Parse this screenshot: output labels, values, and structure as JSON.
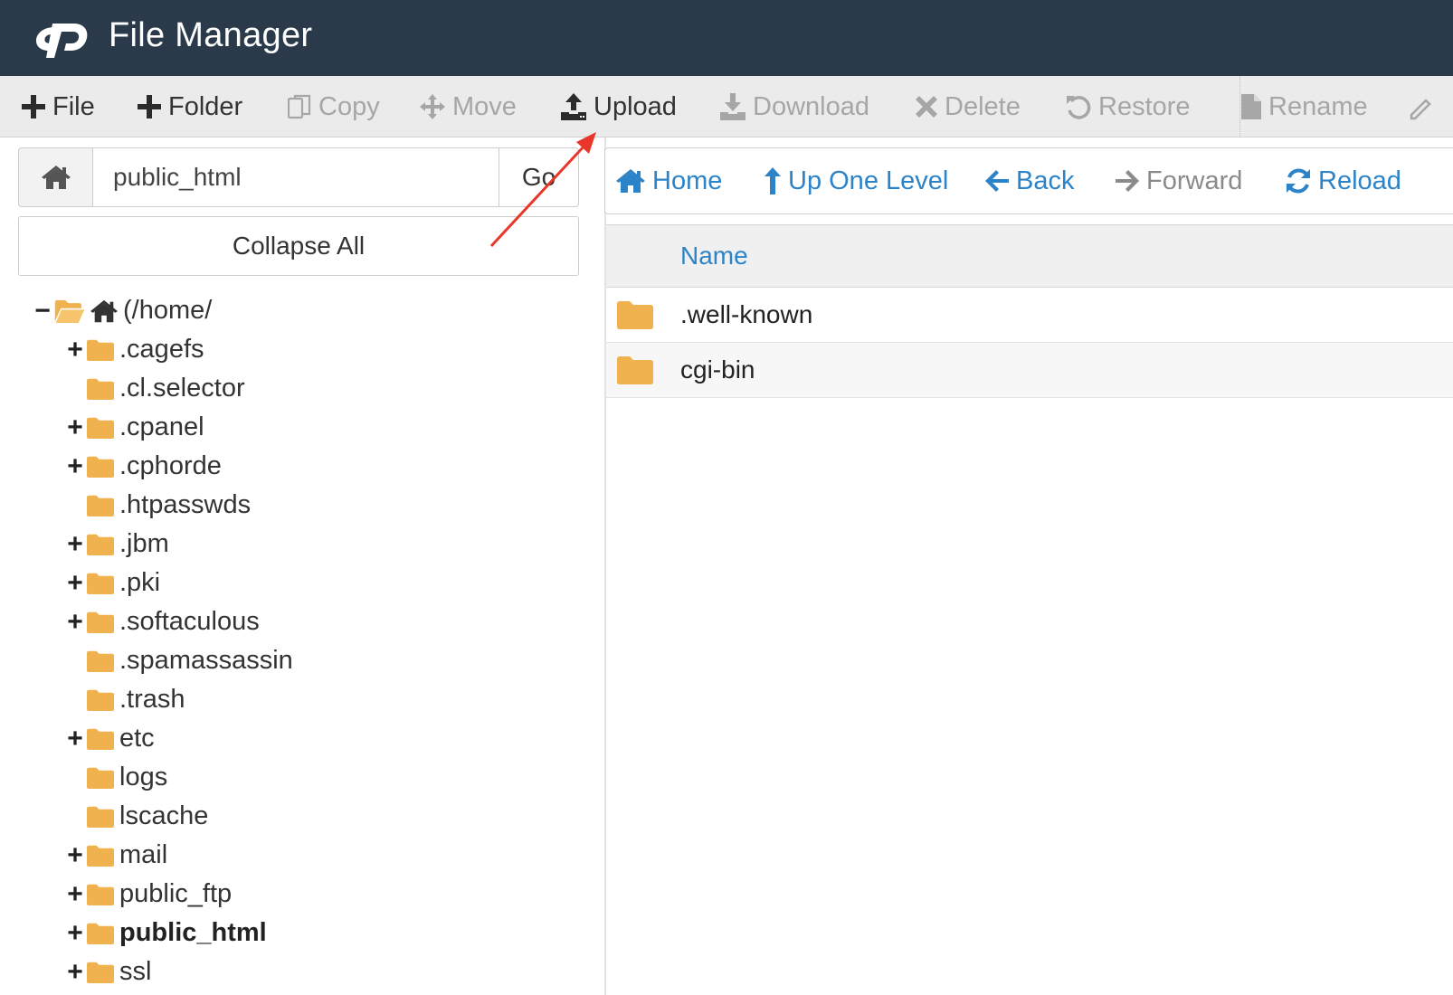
{
  "header": {
    "title": "File Manager",
    "logo_icon": "cpanel-logo"
  },
  "toolbar": {
    "items": [
      {
        "label": "File",
        "icon": "plus-icon",
        "enabled": true
      },
      {
        "label": "Folder",
        "icon": "plus-icon",
        "enabled": true
      },
      {
        "label": "Copy",
        "icon": "copy-icon",
        "enabled": false
      },
      {
        "label": "Move",
        "icon": "move-icon",
        "enabled": false
      },
      {
        "label": "Upload",
        "icon": "upload-icon",
        "enabled": true
      },
      {
        "label": "Download",
        "icon": "download-icon",
        "enabled": false
      },
      {
        "label": "Delete",
        "icon": "times-icon",
        "enabled": false
      },
      {
        "label": "Restore",
        "icon": "undo-icon",
        "enabled": false
      },
      {
        "label": "Rename",
        "icon": "file-icon",
        "enabled": false
      }
    ]
  },
  "left": {
    "path_value": "public_html",
    "go_label": "Go",
    "collapse_label": "Collapse All",
    "tree": [
      {
        "label": "(/home/",
        "toggle": "−",
        "type": "root"
      },
      {
        "label": ".cagefs",
        "toggle": "+"
      },
      {
        "label": ".cl.selector",
        "toggle": ""
      },
      {
        "label": ".cpanel",
        "toggle": "+"
      },
      {
        "label": ".cphorde",
        "toggle": "+"
      },
      {
        "label": ".htpasswds",
        "toggle": ""
      },
      {
        "label": ".jbm",
        "toggle": "+"
      },
      {
        "label": ".pki",
        "toggle": "+"
      },
      {
        "label": ".softaculous",
        "toggle": "+"
      },
      {
        "label": ".spamassassin",
        "toggle": ""
      },
      {
        "label": ".trash",
        "toggle": ""
      },
      {
        "label": "etc",
        "toggle": "+"
      },
      {
        "label": "logs",
        "toggle": ""
      },
      {
        "label": "lscache",
        "toggle": ""
      },
      {
        "label": "mail",
        "toggle": "+"
      },
      {
        "label": "public_ftp",
        "toggle": "+"
      },
      {
        "label": "public_html",
        "toggle": "+",
        "bold": true
      },
      {
        "label": "ssl",
        "toggle": "+"
      }
    ]
  },
  "right": {
    "nav": [
      {
        "label": "Home",
        "icon": "home-icon",
        "active": true
      },
      {
        "label": "Up One Level",
        "icon": "level-up-icon",
        "active": true
      },
      {
        "label": "Back",
        "icon": "arrow-left-icon",
        "active": true
      },
      {
        "label": "Forward",
        "icon": "arrow-right-icon",
        "active": false
      },
      {
        "label": "Reload",
        "icon": "refresh-icon",
        "active": true
      }
    ],
    "column_name": "Name",
    "files": [
      {
        "name": ".well-known",
        "type": "folder"
      },
      {
        "name": "cgi-bin",
        "type": "folder"
      }
    ]
  },
  "colors": {
    "header_bg": "#2a3a4a",
    "accent_blue": "#2d83c7",
    "folder": "#f0b24e",
    "annotation_arrow": "#e8372a"
  }
}
